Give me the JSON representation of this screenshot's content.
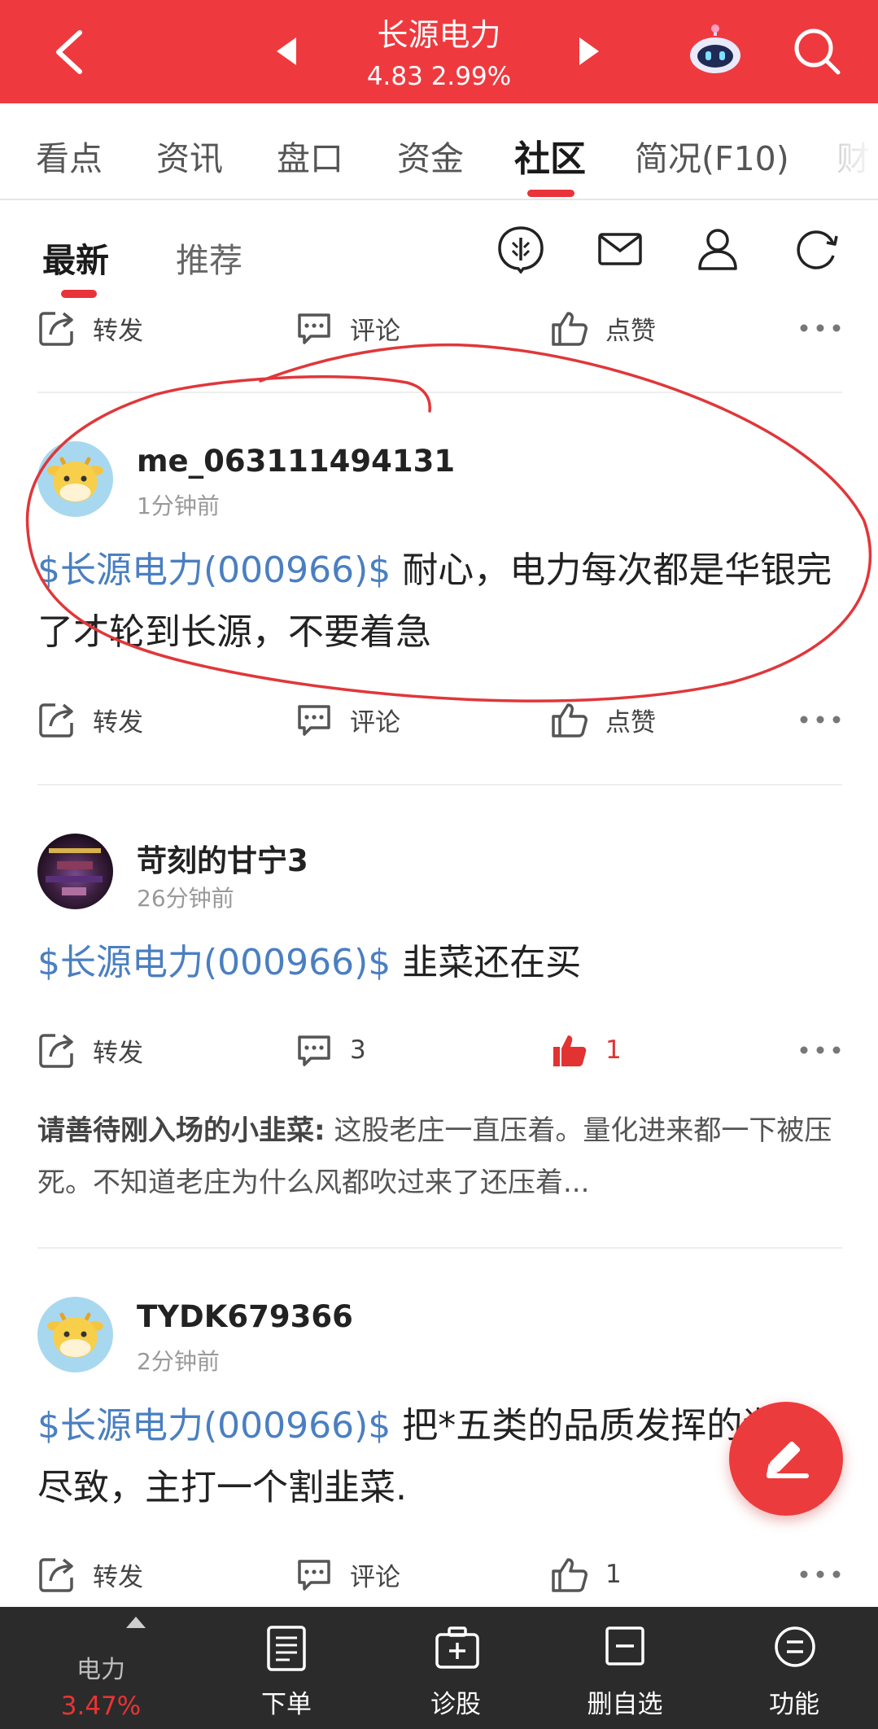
{
  "header": {
    "stock_name": "长源电力",
    "quote": "4.83 2.99%",
    "icons": [
      "back-arrow-icon",
      "prev-stock-icon",
      "next-stock-icon",
      "robot-assistant-icon",
      "search-icon"
    ]
  },
  "tabs": [
    "看点",
    "资讯",
    "盘口",
    "资金",
    "社区",
    "简况(F10)",
    "财"
  ],
  "active_tab": "社区",
  "subtabs": [
    "最新",
    "推荐"
  ],
  "active_subtab": "最新",
  "subtab_icons": [
    "topic-icon",
    "mail-icon",
    "user-icon",
    "refresh-icon"
  ],
  "top_actions": {
    "repost": "转发",
    "comment": "评论",
    "like": "点赞"
  },
  "posts": [
    {
      "username": "me_063111494131",
      "time": "1分钟前",
      "tag": "$长源电力(000966)$",
      "text": " 耐心，电力每次都是华银完了才轮到长源，不要着急",
      "actions": {
        "repost": "转发",
        "comment": "评论",
        "like": "点赞"
      }
    },
    {
      "username": "苛刻的甘宁3",
      "time": "26分钟前",
      "tag": "$长源电力(000966)$",
      "text": " 韭菜还在买",
      "actions": {
        "repost": "转发",
        "comment": "3",
        "like": "1"
      },
      "hot_comment": {
        "author": "请善待刚入场的小韭菜:",
        "text": " 这股老庄一直压着。量化进来都一下被压死。不知道老庄为什么风都吹过来了还压着..."
      }
    },
    {
      "username": "TYDK679366",
      "time": "2分钟前",
      "tag": "$长源电力(000966)$",
      "text": " 把*五类的品质发挥的淋漓尽致，主打一个割韭菜.",
      "actions": {
        "repost": "转发",
        "comment": "评论",
        "like": "1"
      }
    }
  ],
  "bottom_bar": {
    "sector_name": "电力",
    "sector_change": "3.47%",
    "items": [
      "下单",
      "诊股",
      "删自选",
      "功能"
    ]
  },
  "colors": {
    "brand_red": "#ee3a3f",
    "stock_tag_blue": "#4a7fc1",
    "bottom_bar": "#2b2b2b",
    "liked_red": "#e23232"
  }
}
